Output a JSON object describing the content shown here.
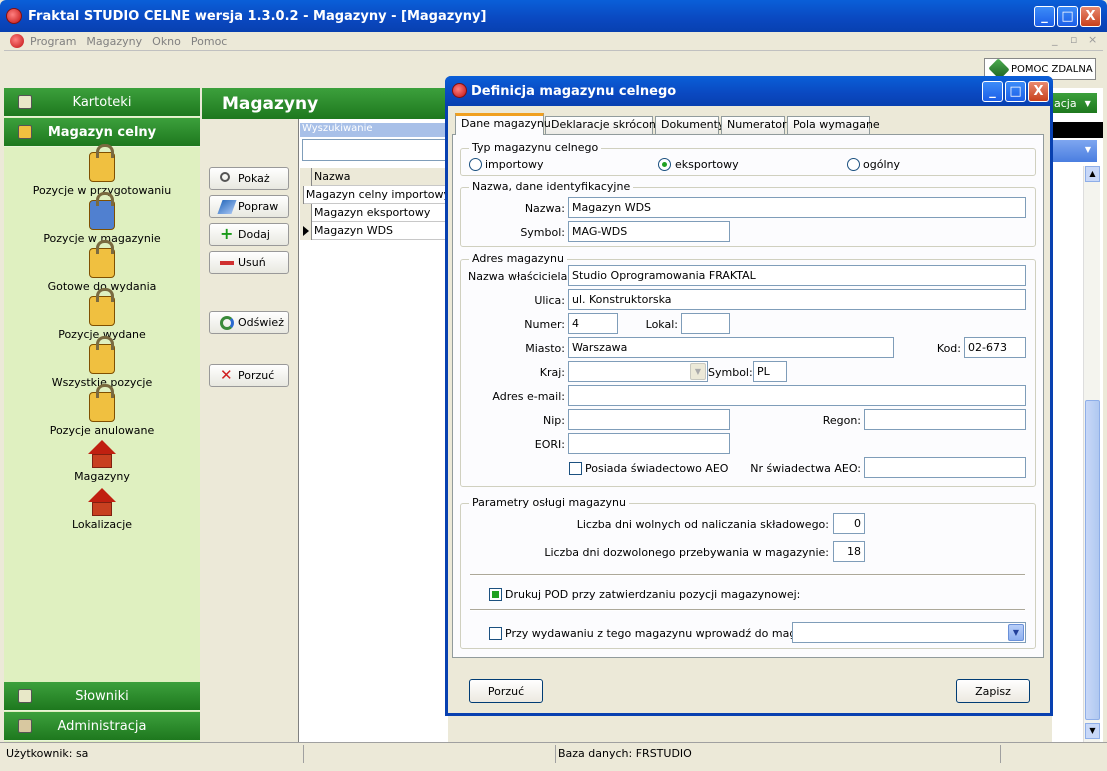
{
  "window": {
    "title": "Fraktal STUDIO CELNE  wersja 1.3.0.2 - Magazyny - [Magazyny]",
    "min": "_",
    "max": "□",
    "close": "X"
  },
  "menu": [
    "Program",
    "Magazyny",
    "Okno",
    "Pomoc"
  ],
  "mdi_controls": {
    "min": "_",
    "restore": "▫",
    "close": "×"
  },
  "toolbar": {
    "remote_help": "POMOC ZDALNA"
  },
  "nav": {
    "kartoteki": "Kartoteki",
    "magazyn_celny": "Magazyn celny",
    "slowniki": "Słowniki",
    "administracja": "Administracja",
    "items": [
      {
        "label": "Pozycje w przygotowaniu",
        "icon": "lock-icon"
      },
      {
        "label": "Pozycje w magazynie",
        "icon": "lock-icon"
      },
      {
        "label": "Gotowe do wydania",
        "icon": "lock-icon"
      },
      {
        "label": "Pozycje wydane",
        "icon": "lock-icon"
      },
      {
        "label": "Wszystkie pozycje",
        "icon": "lock-icon"
      },
      {
        "label": "Pozycje anulowane",
        "icon": "lock-icon"
      },
      {
        "label": "Magazyny",
        "icon": "house-icon"
      },
      {
        "label": "Lokalizacje",
        "icon": "house-icon"
      }
    ]
  },
  "content": {
    "title": "Magazyny",
    "buttons": {
      "pokaz": "Pokaż",
      "popraw": "Popraw",
      "dodaj": "Dodaj",
      "usun": "Usuń",
      "odswiez": "Odśwież",
      "porzuc": "Porzuć"
    },
    "search_label": "Wyszukiwanie",
    "grid_header": "Nazwa",
    "rows": [
      "Magazyn celny importowy",
      "Magazyn eksportowy",
      "Magazyn WDS"
    ],
    "right_combo": "acja"
  },
  "status": {
    "user": "Użytkownik: sa",
    "db": "Baza danych: FRSTUDIO"
  },
  "dialog": {
    "title": "Definicja magazynu celnego",
    "tabs": [
      "Dane magazynu",
      "Deklaracje skrócone",
      "Dokumenty",
      "Numeratory",
      "Pola wymagane"
    ],
    "typ": {
      "title": "Typ magazynu celnego",
      "options": [
        "importowy",
        "eksportowy",
        "ogólny"
      ],
      "selected": "eksportowy"
    },
    "ident": {
      "title": "Nazwa, dane identyfikacyjne",
      "nazwa_label": "Nazwa:",
      "nazwa": "Magazyn WDS",
      "symbol_label": "Symbol:",
      "symbol": "MAG-WDS"
    },
    "adres": {
      "title": "Adres magazynu",
      "owner_label": "Nazwa właściciela:",
      "owner": "Studio Oprogramowania FRAKTAL",
      "ulica_label": "Ulica:",
      "ulica": "ul. Konstruktorska",
      "numer_label": "Numer:",
      "numer": "4",
      "lokal_label": "Lokal:",
      "lokal": "",
      "miasto_label": "Miasto:",
      "miasto": "Warszawa",
      "kod_label": "Kod:",
      "kod": "02-673",
      "kraj_label": "Kraj:",
      "kraj": "",
      "ksymbol_label": "Symbol:",
      "ksymbol": "PL",
      "email_label": "Adres e-mail:",
      "email": "",
      "nip_label": "Nip:",
      "nip": "",
      "regon_label": "Regon:",
      "regon": "",
      "eori_label": "EORI:",
      "eori": "",
      "aeo_label": "Posiada świadectowo AEO",
      "nr_aeo_label": "Nr świadectwa AEO:",
      "nr_aeo": ""
    },
    "params": {
      "title": "Parametry osługi magazynu",
      "free_days_label": "Liczba dni wolnych od naliczania składowego:",
      "free_days": "0",
      "stay_days_label": "Liczba dni dozwolonego przebywania w magazynie:",
      "stay_days": "18",
      "print_pod_label": "Drukuj POD przy zatwierdzaniu pozycji magazynowej:",
      "transfer_label": "Przy wydawaniu z tego magazynu wprowadź do magazynu:",
      "transfer": ""
    },
    "cancel": "Porzuć",
    "save": "Zapisz"
  }
}
